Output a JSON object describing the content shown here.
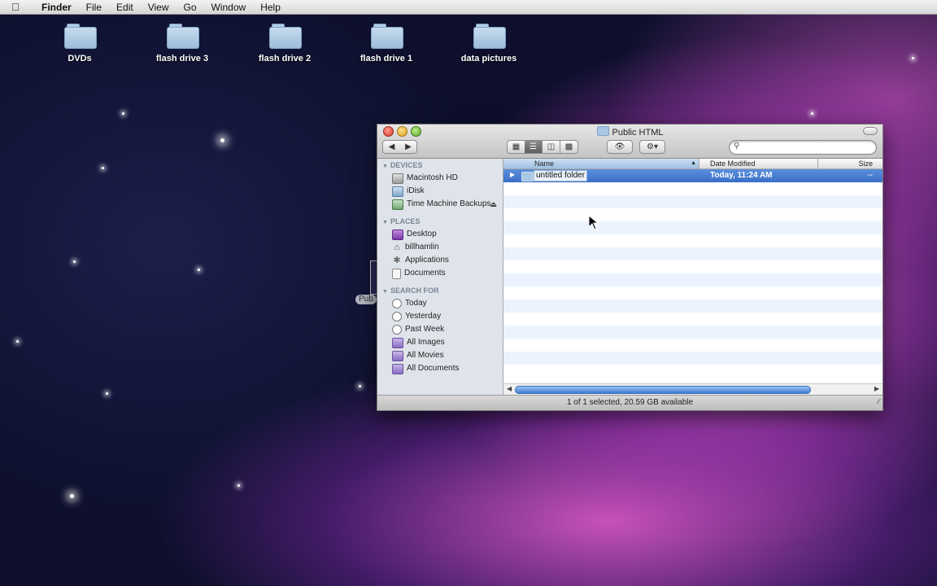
{
  "menubar": {
    "apple_icon": "apple-icon",
    "items": [
      "Finder",
      "File",
      "Edit",
      "View",
      "Go",
      "Window",
      "Help"
    ]
  },
  "desktop": {
    "icons": [
      "DVDs",
      "flash drive 3",
      "flash drive 2",
      "flash drive 1",
      "data pictures"
    ],
    "partial_label": "Pub"
  },
  "window": {
    "title": "Public HTML",
    "sidebar": {
      "devices_header": "DEVICES",
      "devices": [
        "Macintosh HD",
        "iDisk",
        "Time Machine Backups"
      ],
      "places_header": "PLACES",
      "places": [
        "Desktop",
        "billhamlin",
        "Applications",
        "Documents"
      ],
      "search_header": "SEARCH FOR",
      "search": [
        "Today",
        "Yesterday",
        "Past Week",
        "All Images",
        "All Movies",
        "All Documents"
      ]
    },
    "columns": {
      "name": "Name",
      "date": "Date Modified",
      "size": "Size"
    },
    "rows": [
      {
        "name": "untitled folder",
        "date": "Today, 11:24 AM",
        "size": "--"
      }
    ],
    "status": "1 of 1 selected, 20.59 GB available"
  }
}
